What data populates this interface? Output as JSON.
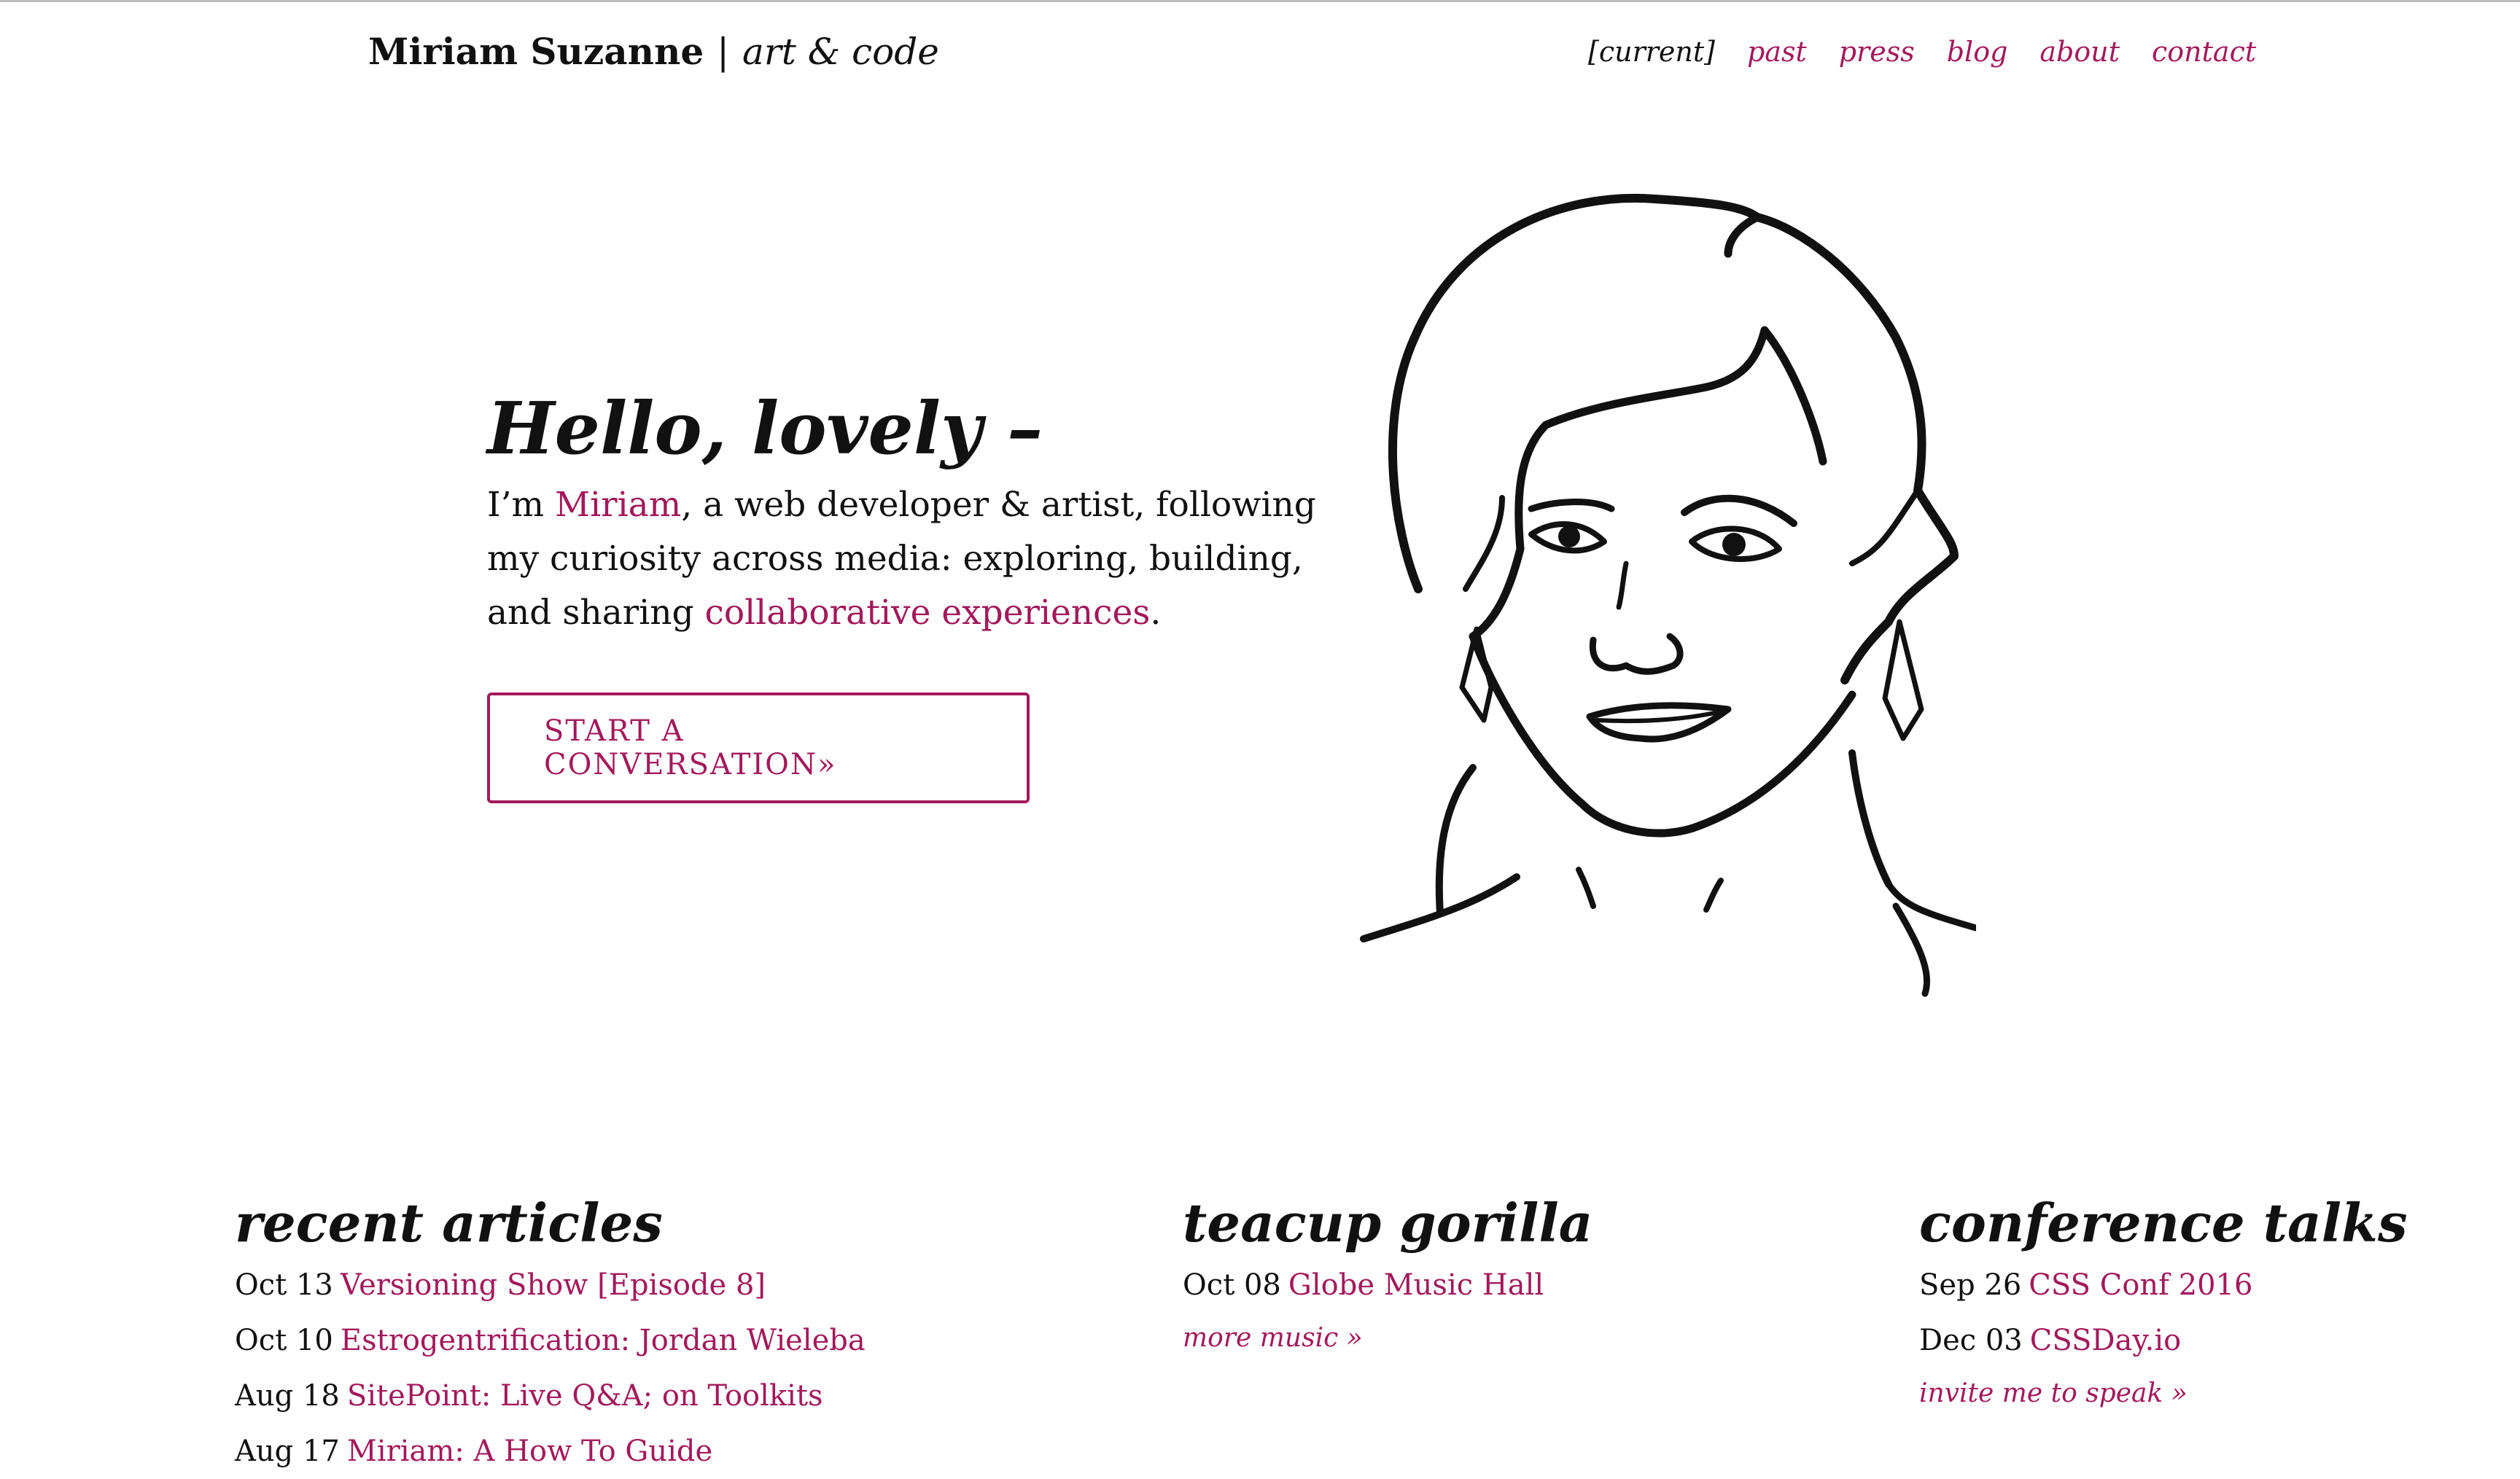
{
  "header": {
    "name": "Miriam Suzanne",
    "separator": "|",
    "tagline": "art & code"
  },
  "nav": {
    "items": [
      {
        "label": "[current]",
        "active": true
      },
      {
        "label": "past",
        "active": false
      },
      {
        "label": "press",
        "active": false
      },
      {
        "label": "blog",
        "active": false
      },
      {
        "label": "about",
        "active": false
      },
      {
        "label": "contact",
        "active": false
      }
    ]
  },
  "hero": {
    "heading": "Hello, lovely –",
    "intro_prefix": "I’m ",
    "intro_link1": "Miriam",
    "intro_mid": ", a web developer & artist, following my curiosity across media: exploring, building, and sharing ",
    "intro_link2": "collaborative experiences",
    "intro_suffix": ".",
    "cta": "START A CONVERSATION»"
  },
  "articles": {
    "title": "recent articles",
    "items": [
      {
        "date": "Oct 13",
        "title": "Versioning Show [Episode 8]"
      },
      {
        "date": "Oct 10",
        "title": "Estrogentrification: Jordan Wieleba"
      },
      {
        "date": "Aug 18",
        "title": "SitePoint: Live Q&A; on Toolkits"
      },
      {
        "date": "Aug 17",
        "title": "Miriam: A How To Guide"
      }
    ]
  },
  "music": {
    "title": "teacup gorilla",
    "items": [
      {
        "date": "Oct 08",
        "title": "Globe Music Hall"
      }
    ],
    "more": "more music »"
  },
  "talks": {
    "title": "conference talks",
    "items": [
      {
        "date": "Sep 26",
        "title": "CSS Conf 2016"
      },
      {
        "date": "Dec 03",
        "title": "CSSDay.io"
      }
    ],
    "more": "invite me to speak »"
  },
  "colors": {
    "accent": "#a3195b",
    "text": "#111111",
    "background": "#ffffff"
  }
}
